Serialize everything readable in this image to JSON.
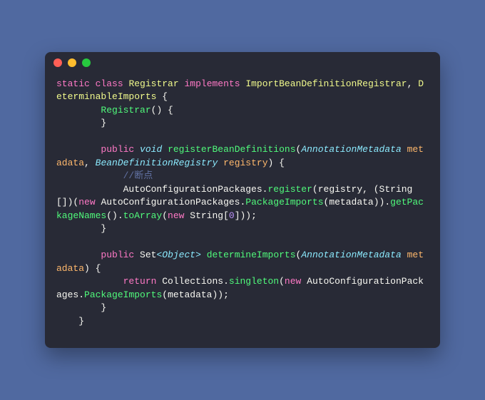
{
  "code": {
    "t_static": "static",
    "t_class": "class",
    "t_Registrar": "Registrar",
    "t_implements": "implements",
    "t_ImportBeanDefinitionRegistrar": "ImportBeanDefinitionRegistrar",
    "t_DeterminableImports": "DeterminableImports",
    "t_RegistrarCtor": "Registrar",
    "t_public1": "public",
    "t_void": "void",
    "t_registerBeanDefinitions": "registerBeanDefinitions",
    "t_AnnotationMetadata": "AnnotationMetadata",
    "t_metadata": "metadata",
    "t_BeanDefinitionRegistry": "BeanDefinitionRegistry",
    "t_registry": "registry",
    "t_comment_break": "//断点",
    "t_AutoConfigurationPackages": "AutoConfigurationPackages",
    "t_register": "register",
    "t_registry2": "registry",
    "t_StringArr": "String",
    "t_new1": "new",
    "t_AutoConfigurationPackages2": "AutoConfigurationPackages",
    "t_PackageImports": "PackageImports",
    "t_metadata2": "metadata",
    "t_getPackageNames": "getPackageNames",
    "t_toArray": "toArray",
    "t_new2": "new",
    "t_String2": "String",
    "t_zero": "0",
    "t_public2": "public",
    "t_Set": "Set",
    "t_lt": "<",
    "t_Object": "Object",
    "t_gt": ">",
    "t_determineImports": "determineImports",
    "t_AnnotationMetadata2": "AnnotationMetadata",
    "t_metadata3": "metadata",
    "t_return": "return",
    "t_Collections": "Collections",
    "t_singleton": "singleton",
    "t_new3": "new",
    "t_AutoConfigurationPackages3": "AutoConfigurationPackages",
    "t_PackageImports2": "PackageImports",
    "t_metadata4": "metadata"
  }
}
